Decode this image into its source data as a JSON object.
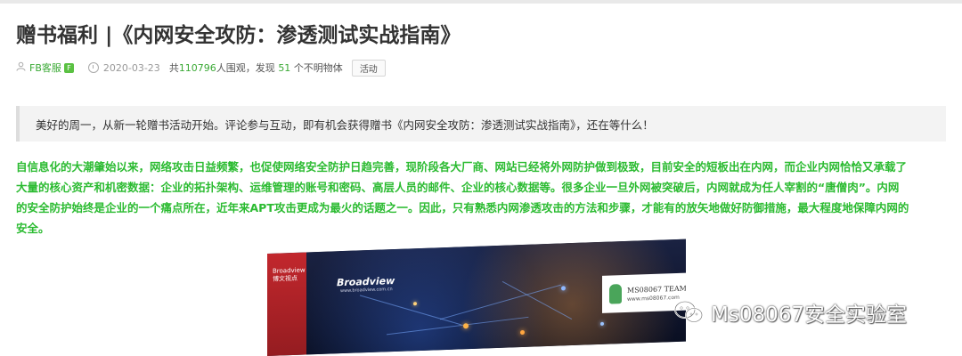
{
  "article": {
    "title": "赠书福利 |《内网安全攻防：渗透测试实战指南》",
    "meta": {
      "author": "FB客服",
      "author_badge": "F",
      "date": "2020-03-23",
      "stats_prefix": "共",
      "views": "110796",
      "stats_mid": "人围观，发现",
      "discoveries": "51",
      "stats_suffix": "个不明物体",
      "tag": "活动",
      "author_icon": "user-icon",
      "date_icon": "clock-icon"
    },
    "quote": "美好的周一，从新一轮赠书活动开始。评论参与互动，即有机会获得赠书《内网安全攻防：渗透测试实战指南》，还在等什么！",
    "body_lines": [
      "自信息化的大潮肇始以来，网络攻击日益频繁，也促使网络安全防护日趋完善，现阶段各大厂商、网站已经将外网防护做到极致，目前安全的短板出在内网，而企业内网恰恰又承载了",
      "大量的核心资产和机密数据：企业的拓扑架构、运维管理的账号和密码、高层人员的邮件、企业的核心数据等。很多企业一旦外网被突破后，内网就成为任人宰割的“唐僧肉”。内网",
      "的安全防护始终是企业的一个痛点所在，近年来APT攻击更成为最火的话题之一。因此，只有熟悉内网渗透攻击的方法和步骤，才能有的放矢地做好防御措施，最大程度地保障内网的",
      "安全。"
    ],
    "body_color": "#2bbb31",
    "book_cover": {
      "publisher": "Broadview",
      "publisher_url": "www.broadview.com.cn",
      "spine_text": "Broadview 博文视点",
      "team_name": "MS08067 TEAM",
      "team_url": "www.ms08067.com"
    }
  },
  "watermark": {
    "icon": "wechat-icon",
    "text": "Ms08067安全实验室"
  },
  "colors": {
    "accent_green": "#3aa935",
    "text_dark": "#333333"
  }
}
